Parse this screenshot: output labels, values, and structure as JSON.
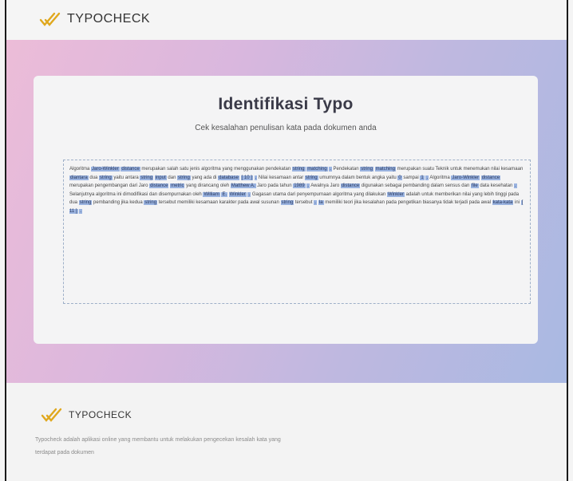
{
  "header": {
    "logo_text": "TYPOCHECK"
  },
  "main": {
    "title": "Identifikasi Typo",
    "subtitle": "Cek kesalahan penulisan kata pada dokumen anda",
    "document_segments": [
      {
        "t": "Algoritma ",
        "h": false
      },
      {
        "t": "Jaro-Winkler",
        "h": true
      },
      {
        "t": " ",
        "h": false
      },
      {
        "t": "distance",
        "h": true
      },
      {
        "t": " merupakan salah satu jenis algoritma yang menggunakan pendekatan ",
        "h": false
      },
      {
        "t": "string",
        "h": true
      },
      {
        "t": " ",
        "h": false
      },
      {
        "t": "matching",
        "h": true
      },
      {
        "t": " ",
        "h": false
      },
      {
        "t": ".",
        "h": true
      },
      {
        "t": " Pendekatan ",
        "h": false
      },
      {
        "t": "string",
        "h": true
      },
      {
        "t": " ",
        "h": false
      },
      {
        "t": "matching",
        "h": true
      },
      {
        "t": " merupakan suatu Teknik untuk menemukan nilai kesamaan ",
        "h": false
      },
      {
        "t": "diantara",
        "h": true
      },
      {
        "t": " dua ",
        "h": false
      },
      {
        "t": "string",
        "h": true
      },
      {
        "t": " yaitu antara ",
        "h": false
      },
      {
        "t": "string",
        "h": true
      },
      {
        "t": " ",
        "h": false
      },
      {
        "t": "input",
        "h": true
      },
      {
        "t": " dan ",
        "h": false
      },
      {
        "t": "string",
        "h": true
      },
      {
        "t": " yang ada di ",
        "h": false
      },
      {
        "t": "database",
        "h": true
      },
      {
        "t": " ",
        "h": false
      },
      {
        "t": "[ 10 ]",
        "h": true
      },
      {
        "t": " ",
        "h": false
      },
      {
        "t": ".",
        "h": true
      },
      {
        "t": " Nilai kesamaan antar ",
        "h": false
      },
      {
        "t": "string",
        "h": true
      },
      {
        "t": " umumnya dalam bentuk angka yaitu ",
        "h": false
      },
      {
        "t": "0",
        "h": true
      },
      {
        "t": " sampai ",
        "h": false
      },
      {
        "t": "1",
        "h": true
      },
      {
        "t": " ",
        "h": false
      },
      {
        "t": ".",
        "h": true
      },
      {
        "t": " Algoritma ",
        "h": false
      },
      {
        "t": "Jaro-Winkler",
        "h": true
      },
      {
        "t": " ",
        "h": false
      },
      {
        "t": "distance",
        "h": true
      },
      {
        "t": " merupakan pengembangan dari Jaro ",
        "h": false
      },
      {
        "t": "distance",
        "h": true
      },
      {
        "t": " ",
        "h": false
      },
      {
        "t": "metric",
        "h": true
      },
      {
        "t": " yang dirancang oleh ",
        "h": false
      },
      {
        "t": "Matthew A.",
        "h": true
      },
      {
        "t": " Jaro pada tahun ",
        "h": false
      },
      {
        "t": "1989",
        "h": true
      },
      {
        "t": " ",
        "h": false
      },
      {
        "t": ".",
        "h": true
      },
      {
        "t": " Awalnya Jaro ",
        "h": false
      },
      {
        "t": "distance",
        "h": true
      },
      {
        "t": " digunakan sebagai pembanding dalam sensus dan ",
        "h": false
      },
      {
        "t": "file",
        "h": true
      },
      {
        "t": " data kesehatan ",
        "h": false
      },
      {
        "t": ".",
        "h": true
      },
      {
        "t": " Selanjutnya algoritma ini dimodifikasi dan disempurnakan oleh ",
        "h": false
      },
      {
        "t": "William",
        "h": true
      },
      {
        "t": " ",
        "h": false
      },
      {
        "t": "E.",
        "h": true
      },
      {
        "t": " ",
        "h": false
      },
      {
        "t": "Winkler",
        "h": true
      },
      {
        "t": " ",
        "h": false
      },
      {
        "t": ".",
        "h": true
      },
      {
        "t": " Gagasan utama dari penyempurnaan algoritma yang dilakukan ",
        "h": false
      },
      {
        "t": "Winkler",
        "h": true
      },
      {
        "t": " adalah untuk memberikan nilai yang lebih tinggi pada dua ",
        "h": false
      },
      {
        "t": "string",
        "h": true
      },
      {
        "t": " pembanding jika kedua ",
        "h": false
      },
      {
        "t": "string",
        "h": true
      },
      {
        "t": " tersebut memiliki kesamaan karakter pada awal susunan ",
        "h": false
      },
      {
        "t": "string",
        "h": true
      },
      {
        "t": " tersebut ",
        "h": false
      },
      {
        "t": ".",
        "h": true
      },
      {
        "t": " ",
        "h": false
      },
      {
        "t": "Ia",
        "h": true
      },
      {
        "t": " memiliki teori jika kesalahan pada pengetikan biasanya tidak terjadi pada awal ",
        "h": false
      },
      {
        "t": "kata-kata",
        "h": true
      },
      {
        "t": " ini ",
        "h": false
      },
      {
        "t": "[ 11 ]",
        "h": true
      },
      {
        "t": " ",
        "h": false
      },
      {
        "t": ".",
        "h": true
      }
    ],
    "highlight_color": "#9ab3e0"
  },
  "footer": {
    "logo_text": "TYPOCHECK",
    "description": "Typocheck adalah aplikasi online yang membantu untuk melakukan pengecekan kesalah kata yang terdapat pada dokumen"
  },
  "icons": {
    "logo": "double-slash-check-logo-icon"
  },
  "colors": {
    "accent": "#e0a81e",
    "hero_gradient": [
      "#ecbcd8",
      "#a9b9e2"
    ],
    "title": "#3a3a48"
  }
}
